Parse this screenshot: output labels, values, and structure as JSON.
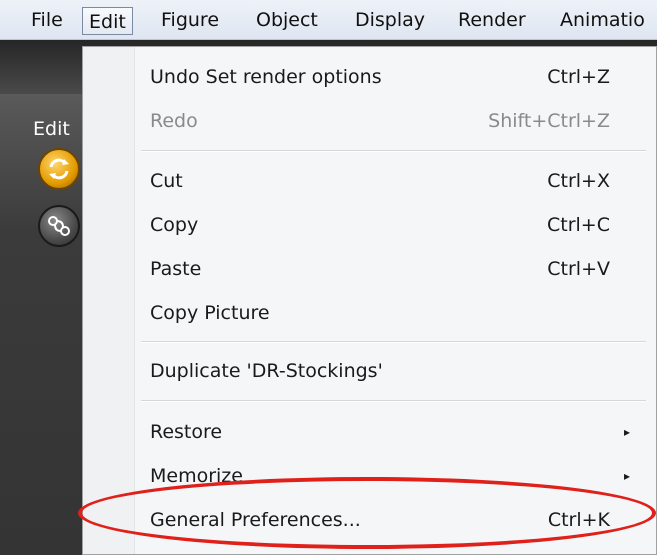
{
  "menubar": {
    "items": [
      {
        "label": "File"
      },
      {
        "label": "Edit"
      },
      {
        "label": "Figure"
      },
      {
        "label": "Object"
      },
      {
        "label": "Display"
      },
      {
        "label": "Render"
      },
      {
        "label": "Animatio"
      }
    ]
  },
  "panel": {
    "label": "Edit"
  },
  "edit_menu": {
    "items": [
      {
        "label": "Undo Set render options",
        "shortcut": "Ctrl+Z"
      },
      {
        "label": "Redo",
        "shortcut": "Shift+Ctrl+Z"
      },
      {
        "label": "Cut",
        "shortcut": "Ctrl+X"
      },
      {
        "label": "Copy",
        "shortcut": "Ctrl+C"
      },
      {
        "label": "Paste",
        "shortcut": "Ctrl+V"
      },
      {
        "label": "Copy Picture",
        "shortcut": ""
      },
      {
        "label": "Duplicate 'DR-Stockings'",
        "shortcut": ""
      },
      {
        "label": "Restore",
        "shortcut": "",
        "arrow": "▸"
      },
      {
        "label": "Memorize",
        "shortcut": "",
        "arrow": "▸"
      },
      {
        "label": "General Preferences...",
        "shortcut": "Ctrl+K"
      }
    ]
  },
  "colors": {
    "highlight_ring": "#e0201a",
    "menu_bg": "#f5f6f7",
    "disabled_text": "#8a8a8a"
  }
}
